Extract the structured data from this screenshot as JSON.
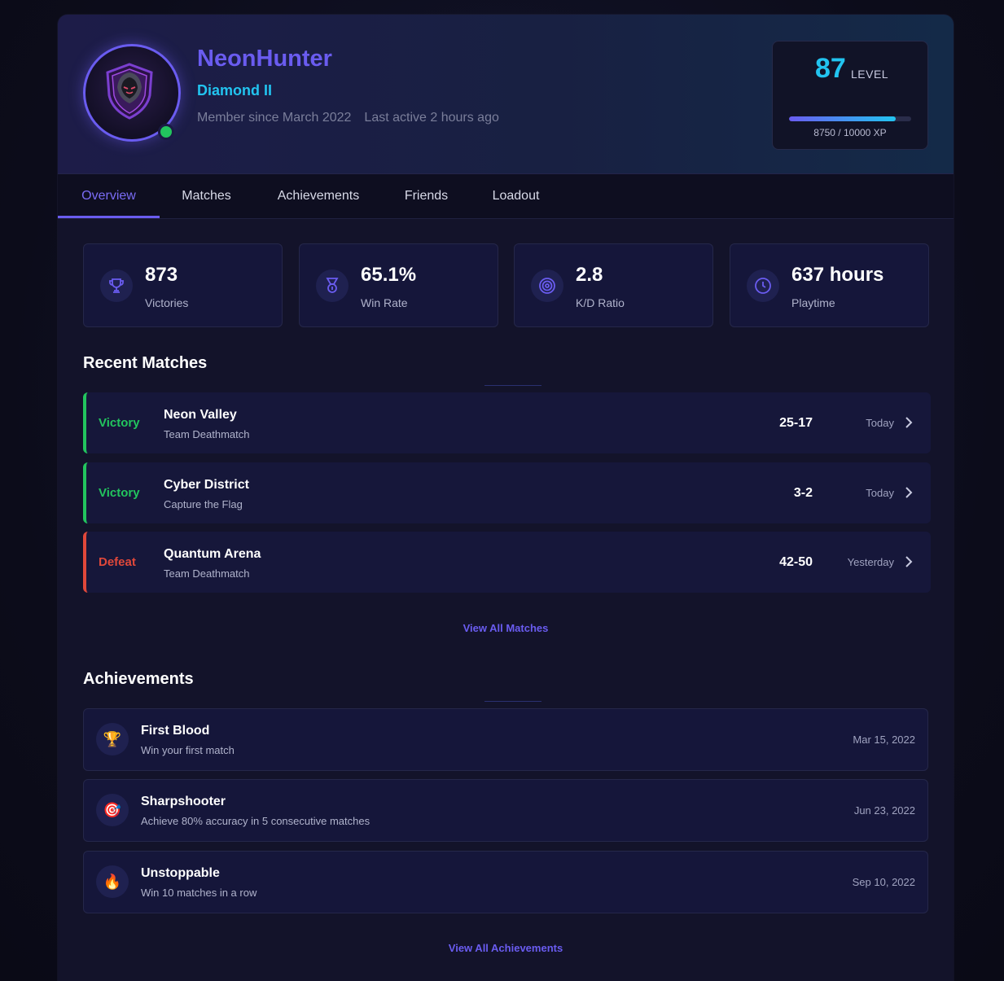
{
  "profile": {
    "username": "NeonHunter",
    "rank": "Diamond II",
    "member_since": "Member since March 2022",
    "last_active": "Last active 2 hours ago",
    "status": "online"
  },
  "level": {
    "value": "87",
    "label": "LEVEL",
    "xp_text": "8750 / 10000 XP",
    "xp_current": 8750,
    "xp_max": 10000
  },
  "tabs": [
    {
      "label": "Overview",
      "active": true
    },
    {
      "label": "Matches",
      "active": false
    },
    {
      "label": "Achievements",
      "active": false
    },
    {
      "label": "Friends",
      "active": false
    },
    {
      "label": "Loadout",
      "active": false
    }
  ],
  "stats": [
    {
      "value": "873",
      "label": "Victories",
      "icon": "trophy-icon"
    },
    {
      "value": "65.1%",
      "label": "Win Rate",
      "icon": "medal-icon"
    },
    {
      "value": "2.8",
      "label": "K/D Ratio",
      "icon": "target-icon"
    },
    {
      "value": "637 hours",
      "label": "Playtime",
      "icon": "clock-icon"
    }
  ],
  "recent_matches": {
    "title": "Recent Matches",
    "items": [
      {
        "result": "Victory",
        "map": "Neon Valley",
        "mode": "Team Deathmatch",
        "score": "25-17",
        "time": "Today"
      },
      {
        "result": "Victory",
        "map": "Cyber District",
        "mode": "Capture the Flag",
        "score": "3-2",
        "time": "Today"
      },
      {
        "result": "Defeat",
        "map": "Quantum Arena",
        "mode": "Team Deathmatch",
        "score": "42-50",
        "time": "Yesterday"
      }
    ],
    "view_all": "View All Matches"
  },
  "achievements": {
    "title": "Achievements",
    "items": [
      {
        "title": "First Blood",
        "desc": "Win your first match",
        "date": "Mar 15, 2022",
        "icon": "🏆"
      },
      {
        "title": "Sharpshooter",
        "desc": "Achieve 80% accuracy in 5 consecutive matches",
        "date": "Jun 23, 2022",
        "icon": "🎯"
      },
      {
        "title": "Unstoppable",
        "desc": "Win 10 matches in a row",
        "date": "Sep 10, 2022",
        "icon": "🔥"
      }
    ],
    "view_all": "View All Achievements"
  },
  "colors": {
    "accent": "#6a5cf0",
    "cyan": "#22c4f0",
    "victory": "#22c55e",
    "defeat": "#e0483a"
  }
}
